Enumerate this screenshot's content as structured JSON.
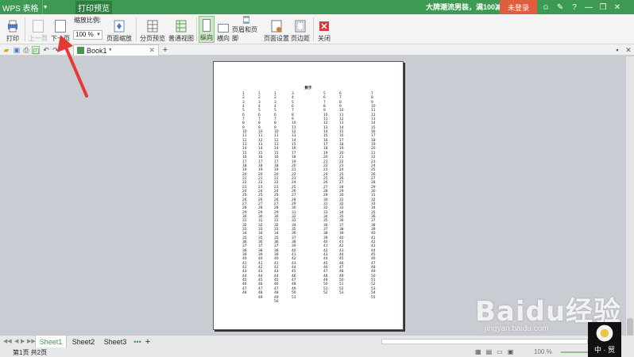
{
  "titlebar": {
    "app_name": "WPS 表格",
    "active_tab": "打印预览",
    "promo": "大牌潮流男装，满100减50",
    "login": "未登录",
    "icons": [
      "feedback-icon",
      "skin-icon",
      "help-icon",
      "minimize-icon",
      "restore-icon",
      "close-icon"
    ]
  },
  "ribbon": {
    "print": "打印",
    "prev_page": "上一页",
    "next_page": "下一页",
    "zoom_label": "缩放比例:",
    "zoom_value": "100 %",
    "page_zoom": "页面缩放",
    "page_break_preview": "分页预览",
    "normal_view": "普通视图",
    "portrait": "纵向",
    "landscape": "横向",
    "header_footer": "页眉和页脚",
    "page_setup": "页面设置",
    "margins": "页边距",
    "close": "关闭"
  },
  "doc_tabs": {
    "active": "Book1 *"
  },
  "page": {
    "title": "数字",
    "columns": [
      {
        "values": [
          "1",
          "2",
          "3",
          "4",
          "5",
          "6",
          "7",
          "8",
          "9",
          "10",
          "11",
          "12",
          "13",
          "14",
          "15",
          "16",
          "17",
          "18",
          "19",
          "20",
          "21",
          "22",
          "23",
          "24",
          "25",
          "26",
          "27",
          "28",
          "29",
          "30",
          "31",
          "32",
          "33",
          "34",
          "35",
          "36",
          "37",
          "38",
          "39",
          "40",
          "41",
          "42",
          "43",
          "44",
          "45",
          "46",
          "47",
          "48"
        ]
      },
      {
        "values": [
          "1",
          "2",
          "3",
          "4",
          "5",
          "6",
          "7",
          "8",
          "9",
          "10",
          "11",
          "12",
          "13",
          "14",
          "15",
          "16",
          "17",
          "18",
          "19",
          "20",
          "21",
          "22",
          "23",
          "24",
          "25",
          "26",
          "27",
          "28",
          "29",
          "30",
          "31",
          "32",
          "33",
          "34",
          "35",
          "36",
          "37",
          "38",
          "39",
          "40",
          "41",
          "42",
          "43",
          "44",
          "45",
          "46",
          "47",
          "48",
          "49"
        ]
      },
      {
        "values": [
          "1",
          "2",
          "3",
          "4",
          "5",
          "6",
          "7",
          "8",
          "9",
          "10",
          "11",
          "12",
          "13",
          "14",
          "15",
          "16",
          "17",
          "18",
          "19",
          "20",
          "21",
          "22",
          "23",
          "24",
          "25",
          "26",
          "27",
          "28",
          "29",
          "30",
          "31",
          "32",
          "33",
          "34",
          "35",
          "36",
          "37",
          "38",
          "39",
          "40",
          "41",
          "42",
          "43",
          "44",
          "45",
          "46",
          "47",
          "48",
          "49",
          "50"
        ]
      },
      {
        "values": [
          "3",
          "4",
          "5",
          "6",
          "7",
          "8",
          "9",
          "10",
          "11",
          "12",
          "13",
          "14",
          "15",
          "16",
          "17",
          "18",
          "19",
          "20",
          "21",
          "22",
          "23",
          "24",
          "25",
          "26",
          "27",
          "28",
          "29",
          "30",
          "31",
          "32",
          "33",
          "34",
          "35",
          "36",
          "37",
          "38",
          "39",
          "40",
          "41",
          "42",
          "43",
          "44",
          "45",
          "46",
          "47",
          "48",
          "49",
          "50",
          "51"
        ]
      },
      {
        "values": [
          "5",
          "6",
          "7",
          "8",
          "9",
          "10",
          "11",
          "12",
          "13",
          "14",
          "15",
          "16",
          "17",
          "18",
          "19",
          "20",
          "21",
          "22",
          "23",
          "24",
          "25",
          "26",
          "27",
          "28",
          "29",
          "30",
          "31",
          "32",
          "33",
          "34",
          "35",
          "36",
          "37",
          "38",
          "39",
          "40",
          "41",
          "42",
          "43",
          "44",
          "45",
          "46",
          "47",
          "48",
          "49",
          "50",
          "51",
          "52"
        ]
      },
      {
        "values": [
          "6",
          "7",
          "8",
          "9",
          "10",
          "11",
          "12",
          "13",
          "14",
          "15",
          "16",
          "17",
          "18",
          "19",
          "20",
          "21",
          "22",
          "23",
          "24",
          "25",
          "26",
          "27",
          "28",
          "29",
          "30",
          "31",
          "32",
          "33",
          "34",
          "35",
          "36",
          "37",
          "38",
          "39",
          "40",
          "41",
          "42",
          "43",
          "44",
          "45",
          "46",
          "47",
          "48",
          "49",
          "50",
          "51",
          "52",
          "53"
        ]
      },
      {
        "values": [
          "7",
          "8",
          "9",
          "10",
          "11",
          "12",
          "13",
          "14",
          "15",
          "16",
          "17",
          "18",
          "19",
          "20",
          "21",
          "22",
          "23",
          "24",
          "25",
          "26",
          "27",
          "28",
          "29",
          "30",
          "31",
          "32",
          "33",
          "34",
          "35",
          "36",
          "37",
          "38",
          "39",
          "40",
          "41",
          "42",
          "43",
          "44",
          "45",
          "46",
          "47",
          "48",
          "49",
          "50",
          "51",
          "52",
          "53",
          "54",
          "55"
        ]
      }
    ]
  },
  "sheets": {
    "tabs": [
      "Sheet1",
      "Sheet2",
      "Sheet3"
    ],
    "more": "•••",
    "add": "+"
  },
  "status": {
    "page_info": "第1页 共2页",
    "zoom": "100 %"
  },
  "watermark": {
    "logo": "Baidu经验",
    "url": "jingyan.baidu.com",
    "corner": "中 · 贸"
  },
  "colors": {
    "titlebar": "#3c9a53",
    "login": "#e05d3d",
    "arrow": "#e53935"
  }
}
